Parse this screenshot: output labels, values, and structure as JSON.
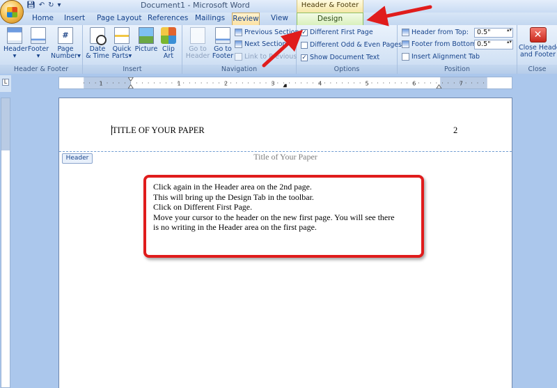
{
  "window": {
    "title": "Document1 - Microsoft Word",
    "contextual_tab_group": "Header & Footer Tools"
  },
  "quick_access": [
    "save-icon",
    "undo-icon",
    "redo-icon",
    "customize-icon"
  ],
  "tabs": [
    {
      "label": "Home"
    },
    {
      "label": "Insert"
    },
    {
      "label": "Page Layout"
    },
    {
      "label": "References"
    },
    {
      "label": "Mailings"
    },
    {
      "label": "Review"
    },
    {
      "label": "View"
    },
    {
      "label": "Design"
    }
  ],
  "ribbon": {
    "groups": {
      "header_footer": {
        "label": "Header & Footer",
        "header_l1": "Header",
        "footer_l1": "Footer",
        "page_number_l1": "Page",
        "page_number_l2": "Number"
      },
      "insert": {
        "label": "Insert",
        "date_l1": "Date",
        "date_l2": "& Time",
        "quick_l1": "Quick",
        "quick_l2": "Parts",
        "picture": "Picture",
        "clip_l1": "Clip",
        "clip_l2": "Art"
      },
      "navigation": {
        "label": "Navigation",
        "goto_header_l1": "Go to",
        "goto_header_l2": "Header",
        "goto_footer_l1": "Go to",
        "goto_footer_l2": "Footer",
        "previous_section": "Previous Section",
        "next_section": "Next Section",
        "link_to_previous": "Link to Previous"
      },
      "options": {
        "label": "Options",
        "different_first_page": "Different First Page",
        "different_odd_even": "Different Odd & Even Pages",
        "show_document_text": "Show Document Text"
      },
      "position": {
        "label": "Position",
        "header_from_top_label": "Header from Top:",
        "header_from_top_value": "0.5\"",
        "footer_from_bottom_label": "Footer from Bottom:",
        "footer_from_bottom_value": "0.5\"",
        "insert_alignment_tab": "Insert Alignment Tab"
      },
      "close": {
        "label": "Close",
        "close_l1": "Close Header",
        "close_l2": "and Footer"
      }
    }
  },
  "ruler": {
    "ticks": [
      "1",
      "1",
      "2",
      "3",
      "4",
      "5",
      "6",
      "7"
    ]
  },
  "document": {
    "header_text": "TITLE OF YOUR PAPER",
    "page_number": "2",
    "header_tag": "Header",
    "previous_page_title": "Title of Your Paper"
  },
  "callout": {
    "lines": [
      "Click again in the Header area on the 2nd page.",
      "This will bring up the Design Tab in the toolbar.",
      "Click on Different First Page.",
      "Move your cursor to the header on the new first page. You will see there",
      "is no writing in the Header area on the first page."
    ]
  },
  "colors": {
    "annotation_red": "#e01c1c",
    "ribbon_blue": "#d4e3f5",
    "design_tab_green": "#d9f0bd"
  }
}
